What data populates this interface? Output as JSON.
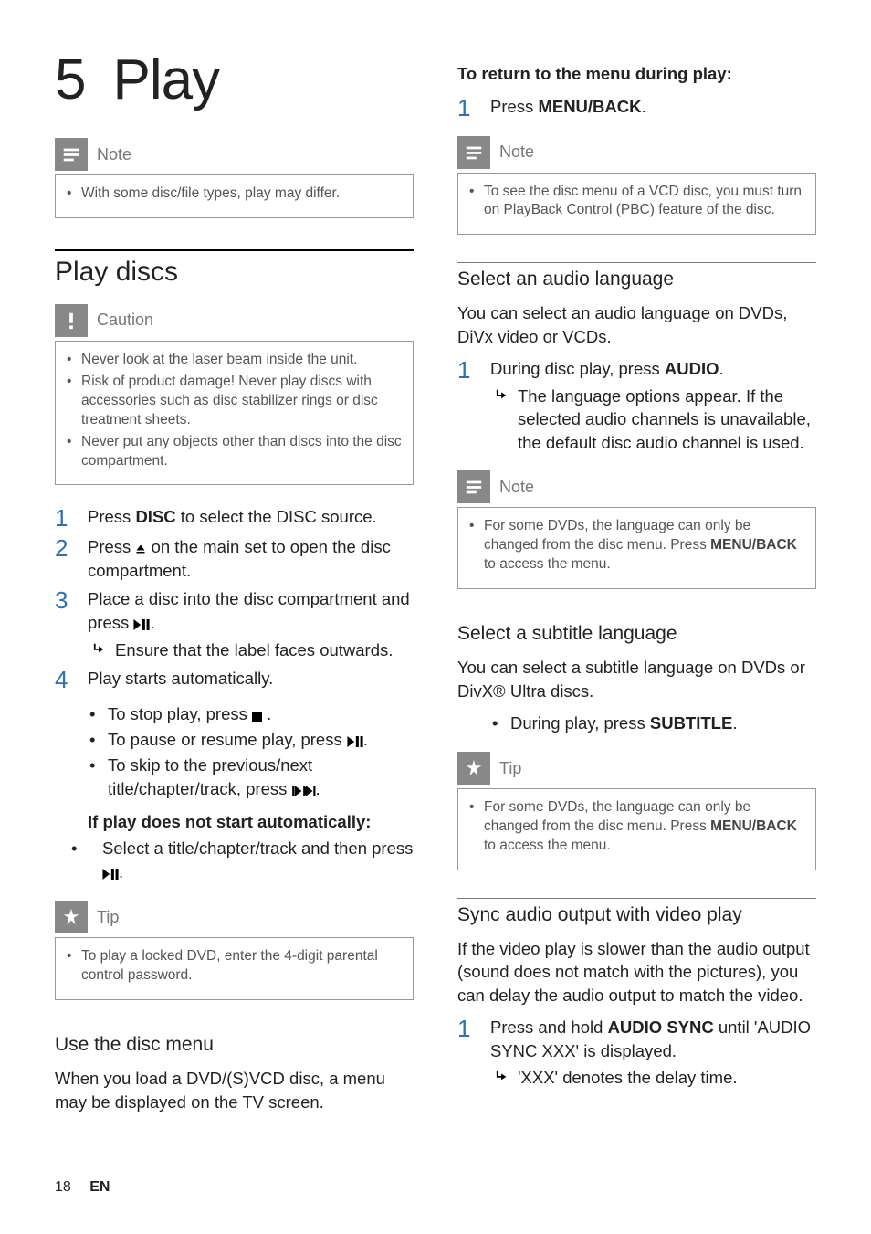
{
  "chapter": {
    "number": "5",
    "title": "Play"
  },
  "left": {
    "note1": {
      "label": "Note",
      "items": [
        "With some disc/file types, play may differ."
      ]
    },
    "section1": {
      "heading": "Play discs",
      "caution": {
        "label": "Caution",
        "items": [
          "Never look at the laser beam inside the unit.",
          "Risk of product damage! Never play discs with accessories such as disc stabilizer rings or disc treatment sheets.",
          "Never put any objects other than discs into the disc compartment."
        ]
      },
      "steps": [
        {
          "n": "1",
          "text_pre": "Press ",
          "bold": "DISC",
          "text_post": " to select the DISC source."
        },
        {
          "n": "2",
          "text_pre": "Press ",
          "icon": "eject",
          "text_post": " on the main set to open the disc compartment."
        },
        {
          "n": "3",
          "text_pre": "Place a disc into the disc compartment and press ",
          "icon": "playpause",
          "text_post": ".",
          "sub": {
            "text": "Ensure that the label faces outwards."
          }
        },
        {
          "n": "4",
          "text_pre": "Play starts automatically."
        }
      ],
      "playbullets": [
        {
          "pre": "To stop play, press ",
          "icon": "stop",
          "post": " ."
        },
        {
          "pre": "To pause or resume play, press ",
          "icon": "playpause",
          "post": "."
        },
        {
          "pre": "To skip to the previous/next title/chapter/track, press ",
          "icon": "prevnext",
          "post": "."
        }
      ],
      "boldline": "If play does not start automatically:",
      "fallback": {
        "pre": "Select a title/chapter/track and then press ",
        "icon": "playpause",
        "post": "."
      },
      "tip": {
        "label": "Tip",
        "items": [
          "To play a locked DVD, enter the 4-digit parental control password."
        ]
      }
    },
    "section2": {
      "heading": "Use the disc menu",
      "body": "When you load a DVD/(S)VCD disc, a menu may be displayed on the TV screen."
    }
  },
  "right": {
    "return": {
      "bold": "To return to the menu during play:",
      "step": {
        "n": "1",
        "pre": "Press ",
        "bold": "MENU/BACK",
        "post": "."
      }
    },
    "note2": {
      "label": "Note",
      "items_html": [
        "To see the disc menu of a VCD disc, you must turn on PlayBack Control (PBC) feature of the disc."
      ]
    },
    "sectionA": {
      "heading": "Select an audio language",
      "body": "You can select an audio language on DVDs, DiVx video or VCDs.",
      "step": {
        "n": "1",
        "pre": "During disc play, press ",
        "bold": "AUDIO",
        "post": ".",
        "sub": "The language options appear. If the selected audio channels is unavailable, the default disc audio channel is used."
      },
      "note": {
        "label": "Note",
        "pre": "For some DVDs, the language can only be changed from the disc menu. Press ",
        "bold": "MENU/BACK",
        "post": " to access the menu."
      }
    },
    "sectionB": {
      "heading": "Select a subtitle language",
      "body": "You can select a subtitle language on DVDs or DivX® Ultra discs.",
      "bullet": {
        "pre": "During play, press ",
        "bold": "SUBTITLE",
        "post": "."
      },
      "tip": {
        "label": "Tip",
        "pre": "For some DVDs, the language can only be changed from the disc menu. Press ",
        "bold": "MENU/BACK",
        "post": " to access the menu."
      }
    },
    "sectionC": {
      "heading": "Sync audio output with video play",
      "body": "If the video play is slower than the audio output (sound does not match with the pictures), you can delay the audio output to match the video.",
      "step": {
        "n": "1",
        "pre": "Press and hold ",
        "bold": "AUDIO SYNC",
        "post": " until 'AUDIO SYNC XXX' is displayed.",
        "sub": "'XXX' denotes the delay time."
      }
    }
  },
  "footer": {
    "page": "18",
    "lang": "EN"
  }
}
